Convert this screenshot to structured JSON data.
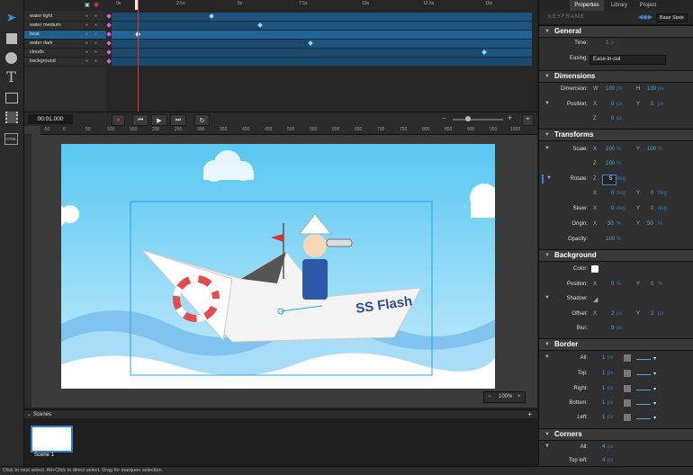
{
  "panel_tabs": [
    "Properties",
    "Library",
    "Project"
  ],
  "keyframe_label": "KEYFRAME",
  "base_state": "Base State",
  "layers": [
    "water light",
    "water medium",
    "boat",
    "water dark",
    "clouds",
    "background"
  ],
  "timeline_ticks": [
    "0s",
    "2.5s",
    "5s",
    "7.5s",
    "10s",
    "12.5s",
    "15s"
  ],
  "timecode": "00:01.000",
  "ruler": [
    "-50",
    "0",
    "50",
    "100",
    "150",
    "200",
    "250",
    "300",
    "350",
    "400",
    "450",
    "500",
    "550",
    "600",
    "650",
    "700",
    "750",
    "800",
    "850",
    "900",
    "950",
    "1000"
  ],
  "stage_text": "SS Flash",
  "zoom": "100%",
  "scenes_title": "Scenes",
  "scene_name": "Scene 1",
  "status": "Click to nest select. Alt+Click to direct select. Drag for marquee selection.",
  "tool_html": "HTML",
  "props": {
    "general": "General",
    "time_label": "Time:",
    "time_val": "1",
    "time_unit": "s",
    "easing_label": "Easing:",
    "easing_val": "Ease-in-out",
    "dimensions": "Dimension",
    "dim_label": "Dimension:",
    "w_val": "100",
    "h_val": "100",
    "position_label": "Position:",
    "pos_x": "0",
    "pos_y": "0",
    "z_val": "0",
    "transforms": "Transforms",
    "scale_label": "Scale:",
    "scale_x": "100",
    "scale_y": "100",
    "scale_z": "100",
    "rotate_label": "Rotate:",
    "rot_z": "5",
    "rot_x": "0",
    "rot_y": "0",
    "skew_label": "Skew:",
    "skew_x": "0",
    "skew_y": "0",
    "origin_label": "Origin:",
    "origin_x": "50",
    "origin_y": "50",
    "opacity_label": "Opacity:",
    "opacity_val": "100",
    "background": "Background",
    "color_label": "Color:",
    "bg_pos_label": "Position:",
    "bg_x": "0",
    "bg_y": "0",
    "shadow_label": "Shadow:",
    "offset_label": "Offset:",
    "off_x": "2",
    "off_y": "2",
    "blur_label": "Blur:",
    "blur_val": "9",
    "border": "Border",
    "all_label": "All:",
    "top_label": "Top:",
    "right_label": "Right:",
    "bottom_label": "Bottom:",
    "left_label": "Left:",
    "b_val": "1",
    "corners": "Corners",
    "c_all_label": "All:",
    "c_all_val": "4",
    "top_left_label": "Top left:",
    "top_left_val": "4",
    "u_px": "px",
    "u_pct": "%",
    "u_deg": "deg",
    "u_s": "s"
  }
}
